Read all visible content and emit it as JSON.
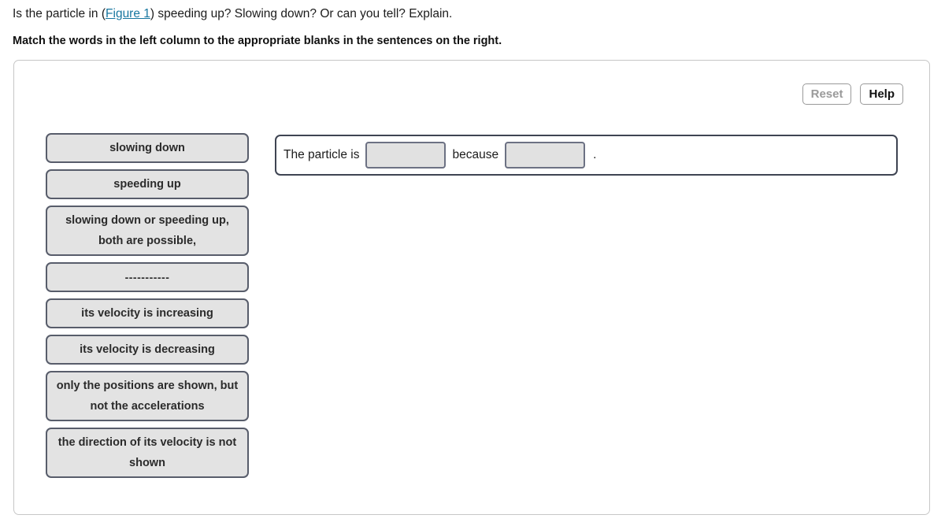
{
  "prompt": {
    "question_before_link": "Is the particle in (",
    "figure_link_label": "Figure 1",
    "question_after_link": ") speeding up? Slowing down? Or can you tell? Explain.",
    "instruction": "Match the words in the left column to the appropriate blanks in the sentences on the right."
  },
  "toolbar": {
    "reset_label": "Reset",
    "help_label": "Help"
  },
  "word_bank": {
    "tiles": [
      {
        "label": "slowing down",
        "lines": 1
      },
      {
        "label": "speeding up",
        "lines": 1
      },
      {
        "label": "slowing down or speeding up, both are possible,",
        "lines": 2
      },
      {
        "label": "-----------",
        "lines": 1
      },
      {
        "label": "its velocity is increasing",
        "lines": 1
      },
      {
        "label": "its velocity is decreasing",
        "lines": 1
      },
      {
        "label": "only the positions are shown, but not the accelerations",
        "lines": 2
      },
      {
        "label": "the direction of its velocity is not shown",
        "lines": 2
      }
    ]
  },
  "sentence": {
    "lead_text": "The particle is",
    "slot_1_value": "",
    "middle_text": "because",
    "slot_2_value": "",
    "trailing_text": "."
  },
  "colors": {
    "link": "#1877a0",
    "tile_fill": "#e3e3e3",
    "tile_border": "#585d6b",
    "sentence_border": "#3e4452",
    "card_border": "#c7c7c7",
    "disabled_text": "#9a9a9a"
  }
}
